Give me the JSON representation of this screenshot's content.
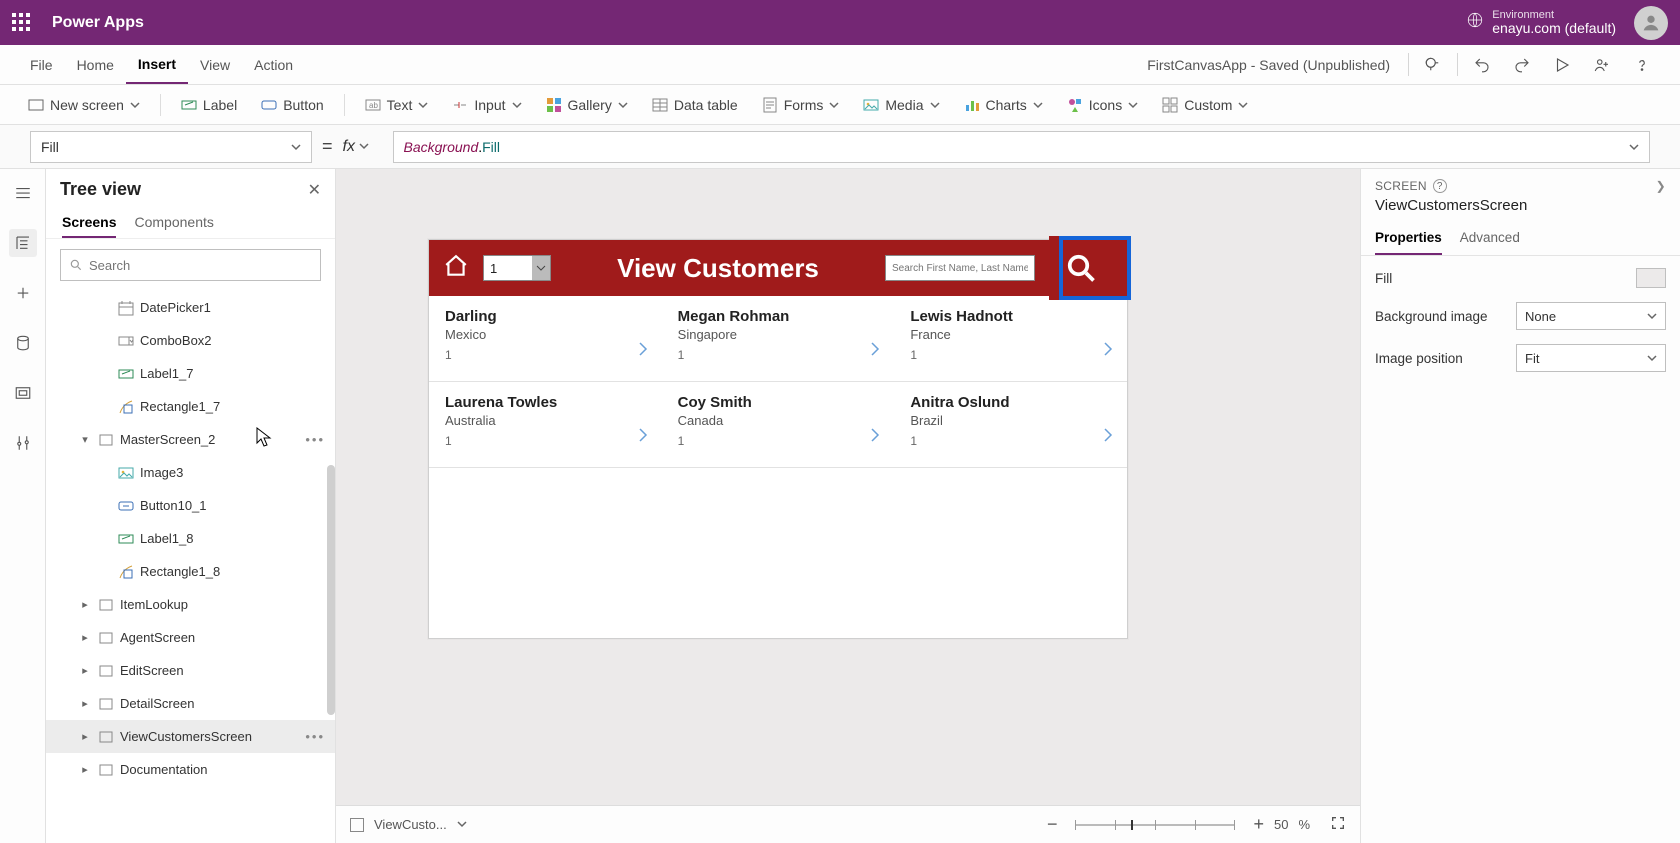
{
  "titlebar": {
    "app": "Power Apps",
    "env_label": "Environment",
    "env_name": "enayu.com (default)"
  },
  "menu": {
    "file": "File",
    "home": "Home",
    "insert": "Insert",
    "view": "View",
    "action": "Action",
    "doc_status": "FirstCanvasApp - Saved (Unpublished)"
  },
  "ribbon": {
    "new_screen": "New screen",
    "label": "Label",
    "button": "Button",
    "text": "Text",
    "input": "Input",
    "gallery": "Gallery",
    "datatable": "Data table",
    "forms": "Forms",
    "media": "Media",
    "charts": "Charts",
    "icons": "Icons",
    "custom": "Custom"
  },
  "formula": {
    "prop": "Fill",
    "obj": "Background",
    "dot": ".",
    "fill": "Fill"
  },
  "treeview": {
    "title": "Tree view",
    "tab_screens": "Screens",
    "tab_components": "Components",
    "search_placeholder": "Search",
    "items": [
      {
        "label": "DatePicker1",
        "icon": "date",
        "depth": 2
      },
      {
        "label": "ComboBox2",
        "icon": "combo",
        "depth": 2
      },
      {
        "label": "Label1_7",
        "icon": "label",
        "depth": 2
      },
      {
        "label": "Rectangle1_7",
        "icon": "rect",
        "depth": 2
      },
      {
        "label": "MasterScreen_2",
        "icon": "screen",
        "depth": 1,
        "exp": "open",
        "dots": true
      },
      {
        "label": "Image3",
        "icon": "image",
        "depth": 2
      },
      {
        "label": "Button10_1",
        "icon": "button",
        "depth": 2
      },
      {
        "label": "Label1_8",
        "icon": "label",
        "depth": 2
      },
      {
        "label": "Rectangle1_8",
        "icon": "rect",
        "depth": 2
      },
      {
        "label": "ItemLookup",
        "icon": "screen",
        "depth": 1,
        "exp": "closed"
      },
      {
        "label": "AgentScreen",
        "icon": "screen",
        "depth": 1,
        "exp": "closed"
      },
      {
        "label": "EditScreen",
        "icon": "screen",
        "depth": 1,
        "exp": "closed"
      },
      {
        "label": "DetailScreen",
        "icon": "screen",
        "depth": 1,
        "exp": "closed"
      },
      {
        "label": "ViewCustomersScreen",
        "icon": "screen",
        "depth": 1,
        "exp": "closed",
        "sel": true,
        "dots": true
      },
      {
        "label": "Documentation",
        "icon": "screen",
        "depth": 1,
        "exp": "closed"
      }
    ]
  },
  "canvas": {
    "header_title": "View Customers",
    "picker_value": "1",
    "search_placeholder": "Search First Name, Last Name, or Ag",
    "customers": [
      {
        "name": "Darling",
        "country": "Mexico",
        "no": "1"
      },
      {
        "name": "Megan  Rohman",
        "country": "Singapore",
        "no": "1"
      },
      {
        "name": "Lewis  Hadnott",
        "country": "France",
        "no": "1"
      },
      {
        "name": "Laurena  Towles",
        "country": "Australia",
        "no": "1"
      },
      {
        "name": "Coy  Smith",
        "country": "Canada",
        "no": "1"
      },
      {
        "name": "Anitra  Oslund",
        "country": "Brazil",
        "no": "1"
      }
    ]
  },
  "status": {
    "crumb": "ViewCusto...",
    "zoom_value": "50",
    "zoom_pct": "%"
  },
  "props": {
    "kind": "SCREEN",
    "name": "ViewCustomersScreen",
    "tab_props": "Properties",
    "tab_adv": "Advanced",
    "fill_label": "Fill",
    "bg_label": "Background image",
    "bg_value": "None",
    "pos_label": "Image position",
    "pos_value": "Fit"
  }
}
